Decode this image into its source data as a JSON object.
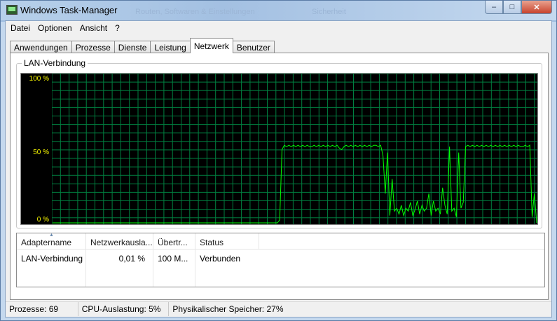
{
  "window": {
    "title": "Windows Task-Manager",
    "buttons": {
      "minimize": "–",
      "maximize": "□",
      "close": "✕"
    },
    "background_ghost_texts": [
      "Routen, Softwaren & Einstellungen",
      "Sicherheit"
    ]
  },
  "menu": [
    "Datei",
    "Optionen",
    "Ansicht",
    "?"
  ],
  "tabs": [
    "Anwendungen",
    "Prozesse",
    "Dienste",
    "Leistung",
    "Netzwerk",
    "Benutzer"
  ],
  "active_tab": "Netzwerk",
  "graph": {
    "title": "LAN-Verbindung",
    "scale_labels": [
      "100 %",
      "50 %",
      "0 %"
    ],
    "colors": {
      "grid": "#008040",
      "line": "#00ff00",
      "scale_text": "#ffff00",
      "background": "#000000"
    },
    "utilization_percent_series": [
      0,
      0,
      0,
      0,
      0,
      0,
      0,
      0,
      0,
      0,
      0,
      0,
      0,
      0,
      0,
      0,
      0,
      0,
      0,
      0,
      0,
      0,
      0,
      0,
      0,
      0,
      0,
      0,
      0,
      0,
      0,
      0,
      0,
      0,
      0,
      0,
      0,
      0,
      0,
      0,
      0,
      0,
      0,
      0,
      0,
      0,
      0,
      0,
      0,
      0,
      0,
      0,
      0,
      0,
      0,
      0,
      0,
      0,
      0,
      0,
      0,
      0,
      0,
      0,
      0,
      0,
      0,
      0,
      0,
      0,
      0,
      0,
      0,
      0,
      0,
      0,
      0,
      0,
      0,
      0,
      0,
      0,
      0,
      0,
      0,
      0,
      0,
      0,
      0,
      0,
      0,
      0,
      0,
      0,
      0,
      0,
      0,
      0,
      0,
      2,
      50,
      53,
      52,
      53,
      52,
      53,
      52,
      53,
      52,
      53,
      52,
      53,
      52,
      52,
      53,
      52,
      53,
      52,
      53,
      52,
      53,
      52,
      53,
      52,
      53,
      51,
      50,
      52,
      53,
      52,
      53,
      52,
      53,
      52,
      53,
      52,
      53,
      52,
      53,
      52,
      53,
      53,
      52,
      53,
      46,
      20,
      48,
      5,
      30,
      8,
      10,
      6,
      12,
      5,
      10,
      8,
      14,
      5,
      9,
      15,
      6,
      12,
      8,
      10,
      20,
      5,
      15,
      8,
      10,
      6,
      24,
      12,
      6,
      52,
      8,
      10,
      4,
      48,
      10,
      14,
      52,
      53,
      52,
      53,
      52,
      53,
      52,
      53,
      52,
      53,
      52,
      53,
      52,
      53,
      52,
      53,
      52,
      53,
      52,
      53,
      52,
      53,
      52,
      53,
      52,
      52,
      53,
      52,
      53,
      4,
      20,
      0
    ]
  },
  "adapter_table": {
    "columns": [
      "Adaptername",
      "Netzwerkausla...",
      "Übertr...",
      "Status"
    ],
    "rows": [
      {
        "name": "LAN-Verbindung",
        "utilization": "0,01 %",
        "speed": "100 M...",
        "status": "Verbunden"
      }
    ]
  },
  "status": {
    "processes": "Prozesse: 69",
    "cpu": "CPU-Auslastung: 5%",
    "memory": "Physikalischer Speicher: 27%"
  }
}
